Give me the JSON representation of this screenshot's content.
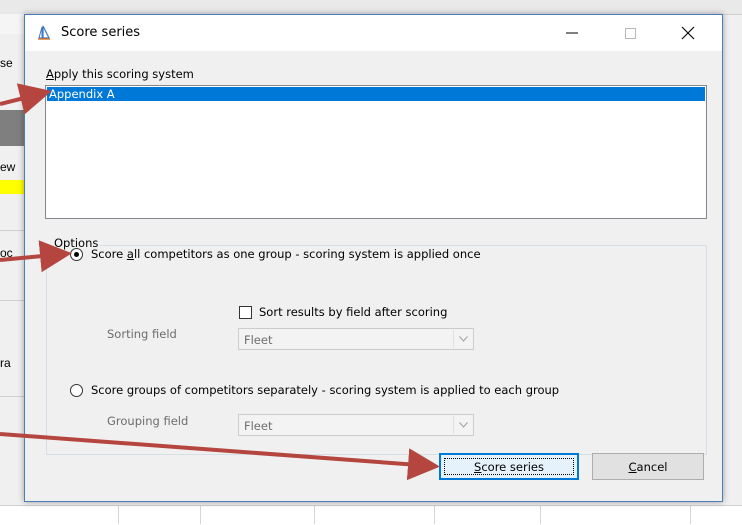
{
  "background": {
    "left_fragments": [
      "se",
      "ew",
      "oc",
      "ra"
    ]
  },
  "dialog": {
    "title": "Score series",
    "title_icon": "sailboat-icon",
    "window_controls": {
      "minimize": "—",
      "maximize": "☐",
      "close": "✕"
    },
    "apply_label": "Apply this scoring system",
    "scoring_systems": [
      "Appendix A"
    ],
    "selected_index": 0,
    "options": {
      "group_title": "Options",
      "score_all": {
        "label": "Score all competitors as one group  -  scoring system is applied once",
        "selected": true
      },
      "sort_results": {
        "label": "Sort results by field after scoring",
        "checked": false
      },
      "sorting_field": {
        "label": "Sorting field",
        "value": "Fleet"
      },
      "score_groups": {
        "label": "Score groups of competitors separately  -  scoring system is applied to each group",
        "selected": false
      },
      "grouping_field": {
        "label": "Grouping field",
        "value": "Fleet"
      }
    },
    "buttons": {
      "score": "Score series",
      "cancel": "Cancel"
    }
  },
  "colors": {
    "selection": "#0078d7",
    "arrow": "#b5463f",
    "highlight_yellow": "#ffff00"
  }
}
